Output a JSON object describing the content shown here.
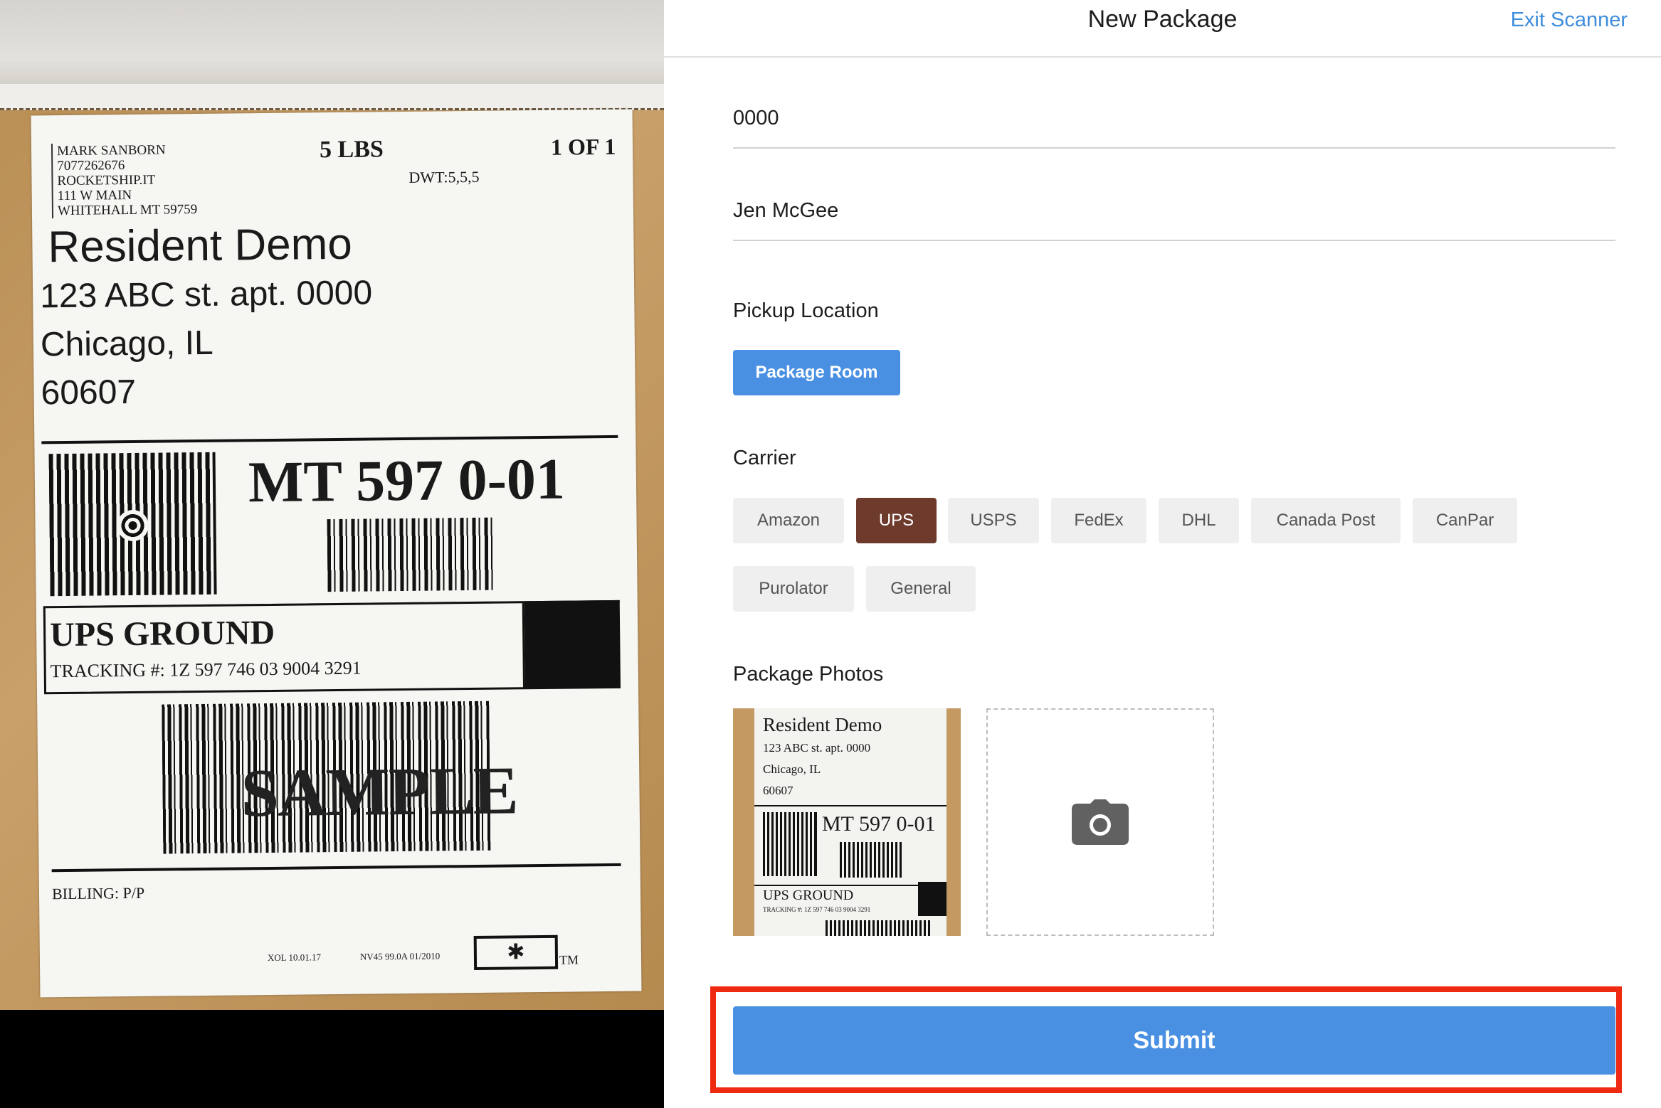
{
  "header": {
    "title": "New Package",
    "exit_label": "Exit Scanner"
  },
  "form": {
    "tracking_value": "0000",
    "recipient_value": "Jen McGee",
    "pickup_label": "Pickup Location",
    "pickup_option": "Package Room",
    "carrier_label": "Carrier",
    "carriers": [
      {
        "label": "Amazon",
        "selected": false
      },
      {
        "label": "UPS",
        "selected": true
      },
      {
        "label": "USPS",
        "selected": false
      },
      {
        "label": "FedEx",
        "selected": false
      },
      {
        "label": "DHL",
        "selected": false
      },
      {
        "label": "Canada Post",
        "selected": false
      },
      {
        "label": "CanPar",
        "selected": false
      },
      {
        "label": "Purolator",
        "selected": false
      },
      {
        "label": "General",
        "selected": false
      }
    ],
    "photos_label": "Package Photos",
    "add_photo_icon": "camera-icon",
    "submit_label": "Submit"
  },
  "camera_label": {
    "sender_lines": [
      "MARK SANBORN",
      "7077262676",
      "ROCKETSHIP.IT",
      "111 W MAIN",
      "WHITEHALL  MT 59759"
    ],
    "weight": "5 LBS",
    "pages": "1 OF 1",
    "dwt": "DWT:5,5,5",
    "recipient_name": "Resident Demo",
    "address_line1": "123 ABC st. apt. 0000",
    "address_line2": "Chicago, IL",
    "address_line3": "60607",
    "route_code": "MT 597 0-01",
    "service": "UPS GROUND",
    "tracking": "TRACKING #: 1Z 597 746 03 9004 3291",
    "sample_mark": "SAMPLE",
    "billing": "BILLING: P/P",
    "footer_left": "XOL 10.01.17",
    "footer_right": "NV45 99.0A 01/2010",
    "trademark": "TM"
  },
  "thumbnail": {
    "name": "Resident Demo",
    "line1": "123 ABC st. apt. 0000",
    "line2": "Chicago, IL",
    "line3": "60607",
    "route_code": "MT 597 0-01",
    "service": "UPS GROUND",
    "tracking": "TRACKING #: 1Z 597 746 03 9004 3291"
  },
  "colors": {
    "accent": "#4a90e2",
    "selected_carrier": "#6e3a2c",
    "highlight_outline": "#ef2a12"
  }
}
